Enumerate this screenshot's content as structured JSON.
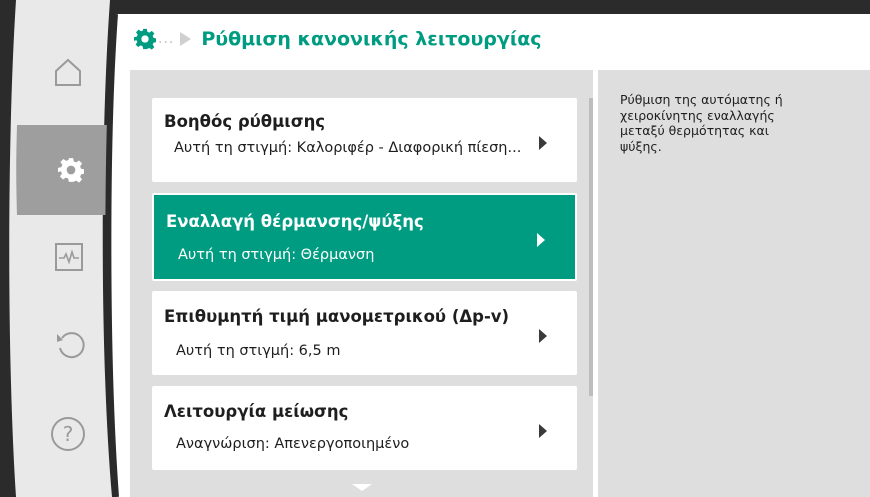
{
  "header": {
    "icon": "gear-icon",
    "ellipsis": "...",
    "title": "Ρύθμιση κανονικής λειτουργίας"
  },
  "sidebar": {
    "items": [
      {
        "icon": "home-icon",
        "active": false
      },
      {
        "icon": "gear-icon",
        "active": true
      },
      {
        "icon": "diagnostics-icon",
        "active": false
      },
      {
        "icon": "undo-icon",
        "active": false
      },
      {
        "icon": "help-icon",
        "active": false
      }
    ]
  },
  "menu": {
    "items": [
      {
        "title": "Βοηθός ρύθμισης",
        "subtitle": "Αυτή τη στιγμή: Καλοριφέρ - Διαφορική πίεση...",
        "selected": false
      },
      {
        "title": "Εναλλαγή θέρμανσης/ψύξης",
        "subtitle": "Αυτή τη στιγμή: Θέρμανση",
        "selected": true
      },
      {
        "title": "Επιθυμητή τιμή μανομετρικού (Δp-v)",
        "subtitle": "Αυτή τη στιγμή: 6,5 m",
        "selected": false
      },
      {
        "title": "Λειτουργία μείωσης",
        "subtitle": "Αναγνώριση: Απενεργοποιημένο",
        "selected": false
      }
    ]
  },
  "help": {
    "text": "Ρύθμιση της αυτόματης ή χειροκίνητης εναλλαγής μεταξύ θερμότητας και ψύξης."
  },
  "colors": {
    "accent": "#009c82",
    "bezel": "#2b2b2b",
    "panel": "#dedede"
  }
}
